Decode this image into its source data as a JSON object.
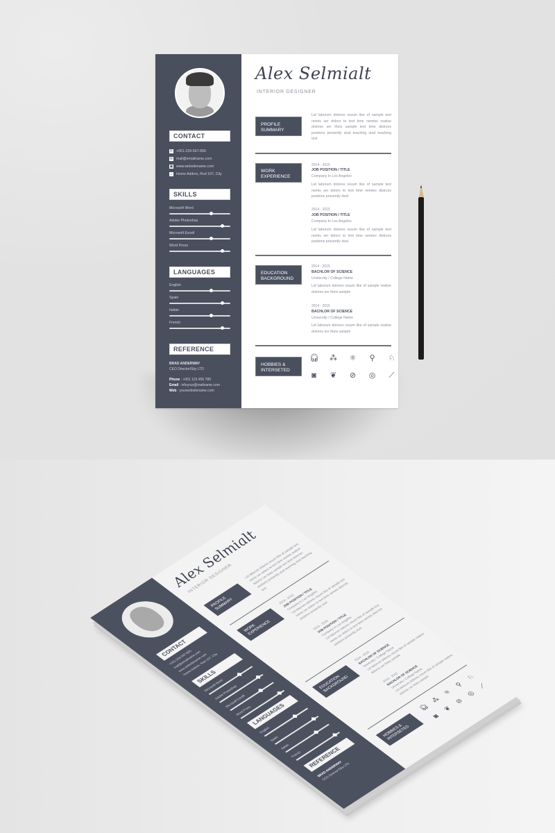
{
  "resume": {
    "name": "Alex Selmialt",
    "role": "INTERIOR DESIGNER",
    "colors": {
      "sidebar": "#4a4f5e",
      "paper": "#ffffff",
      "background": "#e2e2e2"
    },
    "sidebar": {
      "contact": {
        "heading": "CONTACT",
        "items": [
          {
            "icon": "phone-icon",
            "glyph": "✆",
            "text": "+001-234-567-890"
          },
          {
            "icon": "mail-icon",
            "glyph": "✉",
            "text": "mail@emailname.com"
          },
          {
            "icon": "web-icon",
            "glyph": "▣",
            "text": "www.websitename.com"
          },
          {
            "icon": "home-icon",
            "glyph": "⌂",
            "text": "Home Addres, Rod 107, City"
          }
        ]
      },
      "skills": {
        "heading": "SKILLS",
        "items": [
          {
            "label": "Microsoft Word",
            "level": 0.68
          },
          {
            "label": "Adobe Photoshop",
            "level": 0.86
          },
          {
            "label": "Microsoft Excell",
            "level": 0.68
          },
          {
            "label": "Word Press",
            "level": 0.86
          }
        ]
      },
      "languages": {
        "heading": "LANGUAGES",
        "items": [
          {
            "label": "English",
            "level": 0.68
          },
          {
            "label": "Spain",
            "level": 0.86
          },
          {
            "label": "Italian",
            "level": 0.68
          },
          {
            "label": "French",
            "level": 0.86
          }
        ]
      },
      "reference": {
        "heading": "REFERENCE",
        "name": "BRAD ANDERWAY",
        "title": "CEO Director/Sky LTD",
        "phone_label": "Phone",
        "phone": " : +001 123 456 789",
        "email_label": "Email",
        "email": " : infoyour@mailname.com",
        "web_label": "Web",
        "web": " : yourwebsitename.com"
      }
    },
    "main": {
      "profile": {
        "heading_line1": "PROFILE",
        "heading_line2": "SUMMARY",
        "text": "Lid laborum dolores resum like of sample text nemis ser dolors to text time nemies reative dolores ser theis sample text time distrces positons presently stud teaching stud teaching text"
      },
      "work": {
        "heading_line1": "WORK",
        "heading_line2": "EXPERIENCE",
        "entries": [
          {
            "date": "2014 - 2015",
            "title": "JOB POSITION / TITLE",
            "sub": "Company In Los Angeles",
            "text": "Lid laborum dolores resum like of sample text nemis ser dolors to text time nemies distrces positons presently stud"
          },
          {
            "date": "2014 - 2015",
            "title": "JOB POSITION / TITLE",
            "sub": "Company In Los Angeles",
            "text": "Lid laborum dolores resum like of sample text nemis ser dolors to text time nemies distrces positons presently stud"
          }
        ]
      },
      "education": {
        "heading_line1": "EDUCATION",
        "heading_line2": "BACKGROUND",
        "entries": [
          {
            "date": "2014 - 2015",
            "title": "BACHLOR OF SCIENCE",
            "sub": "University / College Name",
            "text": "Lid laborum dolores resum like of sample reative dolores ser theis sample"
          },
          {
            "date": "2014 - 2015",
            "title": "BACHLOR OF SCIENCE",
            "sub": "University / College Name",
            "text": "Lid laborum dolores resum like of sample reative dolores ser theis sample"
          }
        ]
      },
      "hobbies": {
        "heading_line1": "HOBBIES &",
        "heading_line2": "INTERSETED",
        "icons": [
          {
            "name": "headphones-icon",
            "glyph": "🎧︎"
          },
          {
            "name": "network-icon",
            "glyph": "⁂"
          },
          {
            "name": "atom-icon",
            "glyph": "⚛"
          },
          {
            "name": "bicycle-icon",
            "glyph": "⚲"
          },
          {
            "name": "chess-knight-icon",
            "glyph": "♘"
          },
          {
            "name": "camera-icon",
            "glyph": "◙"
          },
          {
            "name": "medal-icon",
            "glyph": "❦"
          },
          {
            "name": "football-icon",
            "glyph": "⊘"
          },
          {
            "name": "target-icon",
            "glyph": "◎"
          },
          {
            "name": "baseball-bat-icon",
            "glyph": "⟋"
          }
        ]
      }
    }
  }
}
